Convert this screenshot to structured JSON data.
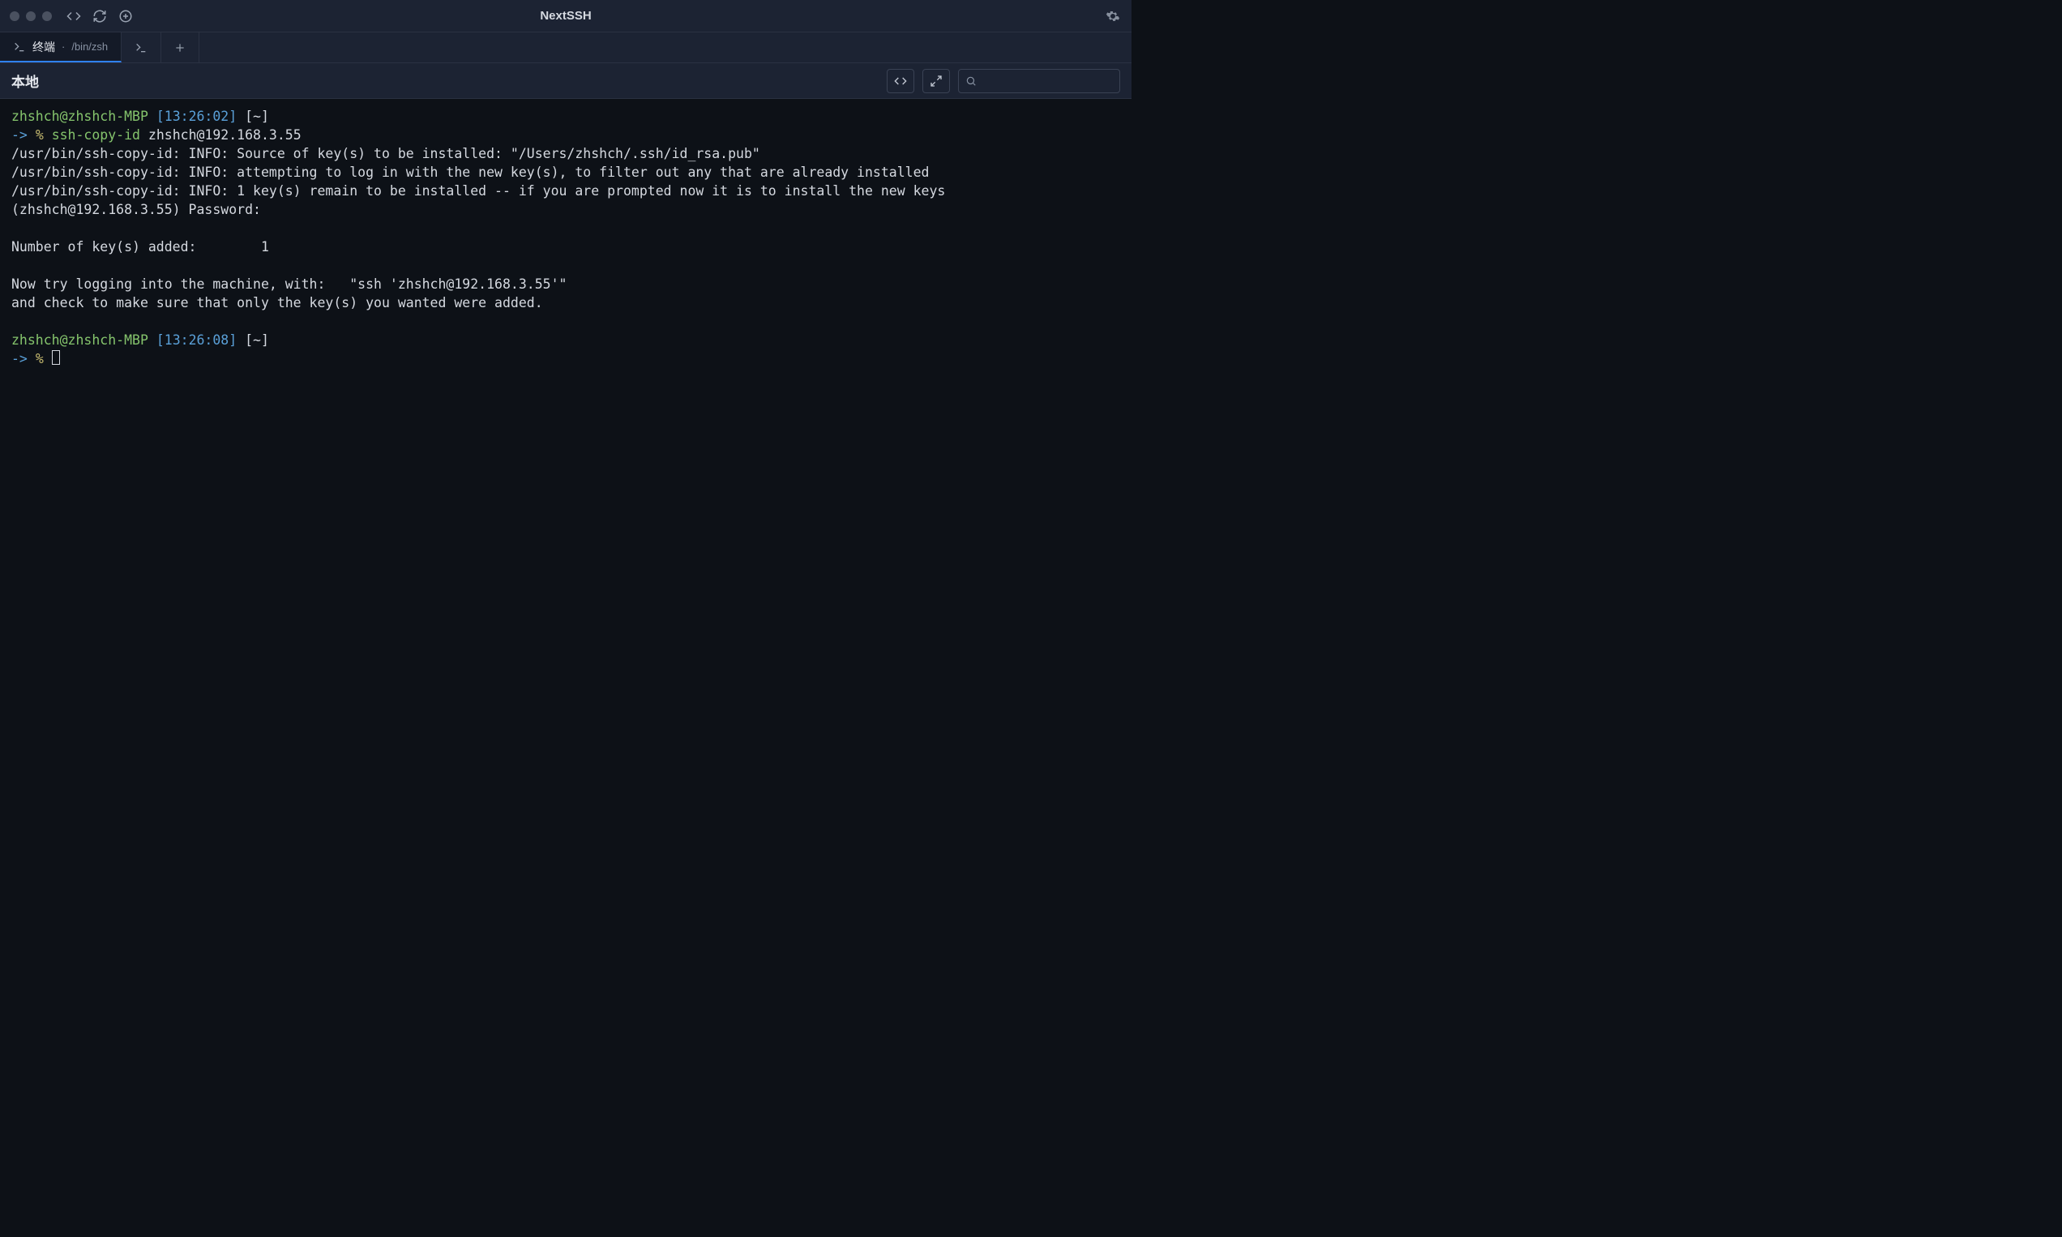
{
  "titlebar": {
    "title": "NextSSH"
  },
  "tabs": {
    "active": {
      "label": "终端",
      "path": "/bin/zsh",
      "separator": " · "
    }
  },
  "toolbar": {
    "title": "本地"
  },
  "search": {
    "placeholder": ""
  },
  "terminal": {
    "prompt1": {
      "userhost": "zhshch@zhshch-MBP",
      "time": "[13:26:02]",
      "path": "[~]",
      "arrow": "->",
      "pct": "%",
      "cmd": "ssh-copy-id",
      "arg": "zhshch@192.168.3.55"
    },
    "l1": "/usr/bin/ssh-copy-id: INFO: Source of key(s) to be installed: \"/Users/zhshch/.ssh/id_rsa.pub\"",
    "l2": "/usr/bin/ssh-copy-id: INFO: attempting to log in with the new key(s), to filter out any that are already installed",
    "l3": "/usr/bin/ssh-copy-id: INFO: 1 key(s) remain to be installed -- if you are prompted now it is to install the new keys",
    "l4": "(zhshch@192.168.3.55) Password:",
    "l5": "Number of key(s) added:        1",
    "l6": "Now try logging into the machine, with:   \"ssh 'zhshch@192.168.3.55'\"",
    "l7": "and check to make sure that only the key(s) you wanted were added.",
    "prompt2": {
      "userhost": "zhshch@zhshch-MBP",
      "time": "[13:26:08]",
      "path": "[~]",
      "arrow": "->",
      "pct": "%"
    }
  }
}
